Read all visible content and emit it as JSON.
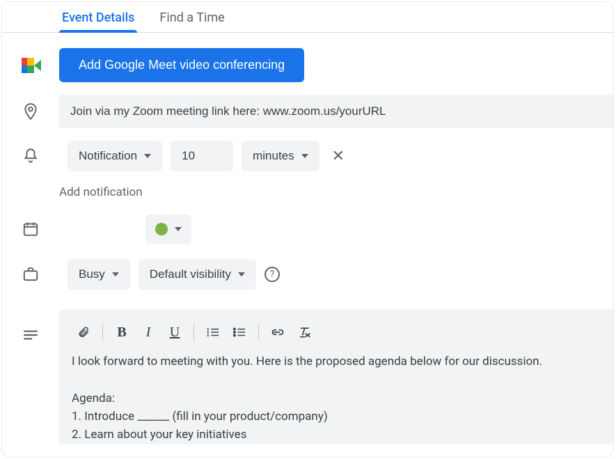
{
  "tabs": {
    "event_details": "Event Details",
    "find_a_time": "Find a Time"
  },
  "conferencing": {
    "add_meet_button": "Add Google Meet video conferencing"
  },
  "location": {
    "value": "Join via my Zoom meeting link here: www.zoom.us/yourURL"
  },
  "notification": {
    "type": "Notification",
    "value": "10",
    "unit": "minutes",
    "add_label": "Add notification"
  },
  "calendar": {
    "color": "#7cb342"
  },
  "availability": {
    "busy": "Busy",
    "visibility": "Default visibility"
  },
  "description": {
    "body": "I look forward to meeting with you. Here is the proposed agenda below for our discussion.\n\nAgenda:\n1. Introduce ______ (fill in your product/company)\n2. Learn about your key initiatives"
  }
}
